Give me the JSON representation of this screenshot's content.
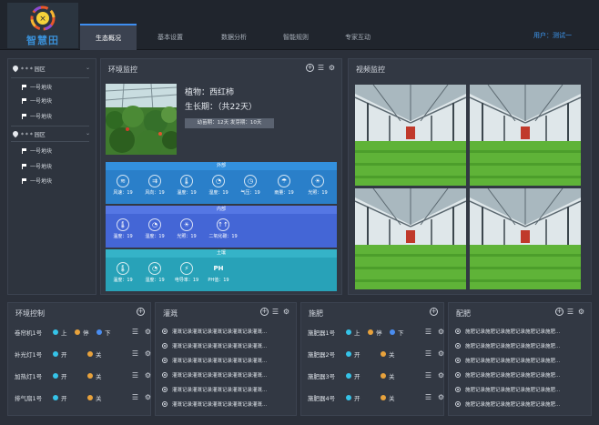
{
  "app": {
    "logo_text": "智慧田",
    "user": "用户：测试一"
  },
  "nav": [
    "生态概况",
    "基本设置",
    "数据分析",
    "智能规则",
    "专家互动"
  ],
  "tree": [
    {
      "label": "* * * 园区",
      "children": [
        "一号地块",
        "一号地块",
        "一号地块"
      ]
    },
    {
      "label": "* * * 园区",
      "children": [
        "一号地块",
        "一号地块",
        "一号地块"
      ]
    }
  ],
  "env": {
    "title": "环境监控",
    "plant": "植物：西红柿",
    "growth": "生长期：（共22天）",
    "badge": "幼苗期：12天 发芽期：10天",
    "sections": [
      {
        "name": "外部",
        "items": [
          {
            "label": "风速：19",
            "icon": "wind-icon"
          },
          {
            "label": "风向：19",
            "icon": "wind-direction-icon"
          },
          {
            "label": "温度：19",
            "icon": "thermometer-icon"
          },
          {
            "label": "湿度：19",
            "icon": "humidity-icon"
          },
          {
            "label": "气压：19",
            "icon": "pressure-icon"
          },
          {
            "label": "雨量：19",
            "icon": "rain-icon"
          },
          {
            "label": "光照：19",
            "icon": "sun-icon"
          }
        ]
      },
      {
        "name": "内部",
        "items": [
          {
            "label": "温度：19",
            "icon": "thermometer-icon"
          },
          {
            "label": "湿度：19",
            "icon": "humidity-icon"
          },
          {
            "label": "光照：19",
            "icon": "sun-icon"
          },
          {
            "label": "二氧化碳：19",
            "icon": "co2-icon"
          }
        ]
      },
      {
        "name": "土壤",
        "items": [
          {
            "label": "温度：19",
            "icon": "thermometer-icon"
          },
          {
            "label": "湿度：19",
            "icon": "humidity-icon"
          },
          {
            "label": "电导率：19",
            "icon": "lightning-icon"
          },
          {
            "label": "PH值：19",
            "icon": "ph-icon",
            "glyph": "PH"
          }
        ]
      }
    ],
    "colors": {
      "outer": "#2a7fc9",
      "inner": "#4466d6",
      "soil": "#28a2b8"
    }
  },
  "video": {
    "title": "视频监控"
  },
  "control": {
    "title": "环境控制",
    "rows": [
      {
        "name": "卷帘机1号",
        "opts": [
          "上",
          "停",
          "下"
        ]
      },
      {
        "name": "补光灯1号",
        "opts": [
          "开",
          "关"
        ]
      },
      {
        "name": "加热灯1号",
        "opts": [
          "开",
          "关"
        ]
      },
      {
        "name": "排气扇1号",
        "opts": [
          "开",
          "关"
        ]
      }
    ]
  },
  "irrigation": {
    "title": "灌溉",
    "records": [
      "灌溉记录灌溉记录灌溉记录灌溉记录灌溉...",
      "灌溉记录灌溉记录灌溉记录灌溉记录灌溉...",
      "灌溉记录灌溉记录灌溉记录灌溉记录灌溉...",
      "灌溉记录灌溉记录灌溉记录灌溉记录灌溉...",
      "灌溉记录灌溉记录灌溉记录灌溉记录灌溉...",
      "灌溉记录灌溉记录灌溉记录灌溉记录灌溉..."
    ]
  },
  "fertilize": {
    "title": "施肥",
    "rows": [
      {
        "name": "施肥器1号",
        "opts": [
          "上",
          "停",
          "下"
        ]
      },
      {
        "name": "施肥器2号",
        "opts": [
          "开",
          "关"
        ]
      },
      {
        "name": "施肥器3号",
        "opts": [
          "开",
          "关"
        ]
      },
      {
        "name": "施肥器4号",
        "opts": [
          "开",
          "关"
        ]
      }
    ]
  },
  "mixing": {
    "title": "配肥",
    "records": [
      "施肥记录施肥记录施肥记录施肥记录施肥...",
      "施肥记录施肥记录施肥记录施肥记录施肥...",
      "施肥记录施肥记录施肥记录施肥记录施肥...",
      "施肥记录施肥记录施肥记录施肥记录施肥...",
      "施肥记录施肥记录施肥记录施肥记录施肥...",
      "施肥记录施肥记录施肥记录施肥记录施肥..."
    ]
  },
  "status_colors": {
    "on": "#35c3e8",
    "stop": "#e8a23c",
    "down": "#4a8df0",
    "off": "#e8a23c"
  }
}
